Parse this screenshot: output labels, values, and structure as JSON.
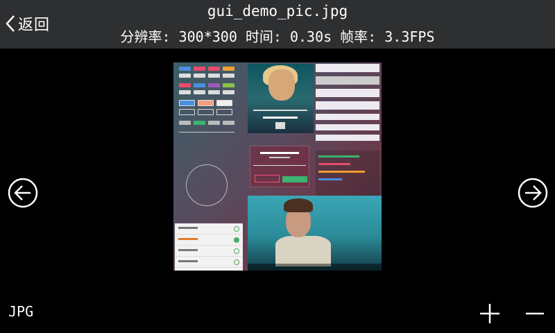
{
  "header": {
    "back_label": "返回",
    "file_name": "gui_demo_pic.jpg",
    "resolution": "分辨率: 300*300",
    "time": "时间: 0.30s",
    "fps": "帧率: 3.3FPS"
  },
  "footer": {
    "format": "JPG"
  },
  "icons": {
    "back": "chevron-left-icon",
    "prev": "circle-arrow-left-icon",
    "next": "circle-arrow-right-icon",
    "zoom_in": "plus-icon",
    "zoom_out": "minus-icon"
  },
  "colors": {
    "topbar": "#2e2f31",
    "background": "#000000",
    "text": "#ffffff"
  }
}
